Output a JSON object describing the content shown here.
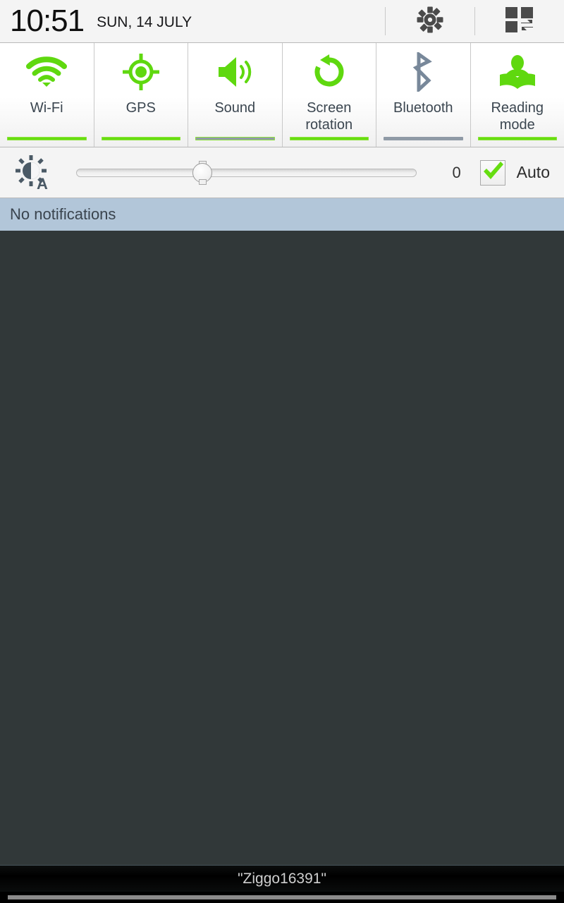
{
  "statusbar": {
    "time": "10:51",
    "date": "SUN, 14 JULY",
    "settings_icon": "gear-icon",
    "quick_settings_icon": "quick-settings-grid-swap-icon"
  },
  "quick_toggles": [
    {
      "id": "wifi",
      "label": "Wi-Fi",
      "icon": "wifi-icon",
      "state": "on",
      "bar_color": "#66dd11",
      "icon_color": "#5fd80f"
    },
    {
      "id": "gps",
      "label": "GPS",
      "icon": "gps-crosshair-icon",
      "state": "on",
      "bar_color": "#66dd11",
      "icon_color": "#5fd80f"
    },
    {
      "id": "sound",
      "label": "Sound",
      "icon": "speaker-sound-icon",
      "state": "on",
      "bar_color": "#66dd11",
      "icon_color": "#5fd80f"
    },
    {
      "id": "screen-rotation",
      "label": "Screen rotation",
      "icon": "rotate-ccw-icon",
      "state": "on",
      "bar_color": "#66dd11",
      "icon_color": "#5fd80f"
    },
    {
      "id": "bluetooth",
      "label": "Bluetooth",
      "icon": "bluetooth-icon",
      "state": "off",
      "bar_color": "#8f9aa6",
      "icon_color": "#78889a"
    },
    {
      "id": "reading-mode",
      "label": "Reading mode",
      "icon": "reading-person-icon",
      "state": "on",
      "bar_color": "#66dd11",
      "icon_color": "#5fd80f"
    }
  ],
  "brightness": {
    "icon": "brightness-auto-icon",
    "value": "0",
    "slider_percent": 36,
    "auto_label": "Auto",
    "auto_checked": true,
    "check_color": "#66dd11"
  },
  "notifications": {
    "empty_text": "No notifications",
    "bar_color": "#b2c6d9"
  },
  "toast": {
    "text": "\"Ziggo16391\""
  },
  "theme": {
    "panel_background": "#313839",
    "accent_on": "#66dd11",
    "accent_off": "#8f9aa6",
    "statusbar_background": "#f4f4f4",
    "tile_text": "#3b4650"
  }
}
